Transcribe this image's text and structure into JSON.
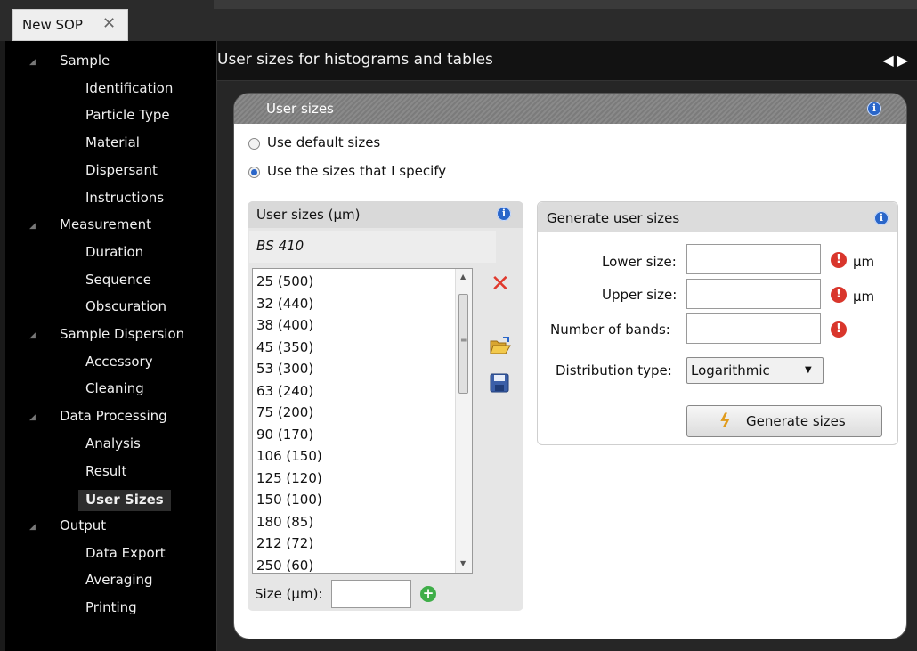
{
  "tab": {
    "label": "New SOP",
    "close": "✕"
  },
  "nav": [
    {
      "label": "Sample",
      "group": true
    },
    {
      "label": "Identification"
    },
    {
      "label": "Particle Type"
    },
    {
      "label": "Material"
    },
    {
      "label": "Dispersant"
    },
    {
      "label": "Instructions"
    },
    {
      "label": "Measurement",
      "group": true
    },
    {
      "label": "Duration"
    },
    {
      "label": "Sequence"
    },
    {
      "label": "Obscuration"
    },
    {
      "label": "Sample Dispersion",
      "group": true
    },
    {
      "label": "Accessory"
    },
    {
      "label": "Cleaning"
    },
    {
      "label": "Data Processing",
      "group": true
    },
    {
      "label": "Analysis"
    },
    {
      "label": "Result"
    },
    {
      "label": "User Sizes",
      "selected": true
    },
    {
      "label": "Output",
      "group": true
    },
    {
      "label": "Data Export"
    },
    {
      "label": "Averaging"
    },
    {
      "label": "Printing"
    }
  ],
  "header": {
    "title": "User sizes for histograms and tables"
  },
  "card": {
    "title": "User sizes"
  },
  "options": {
    "default_sizes": "Use default sizes",
    "specify_sizes": "Use the sizes that I specify",
    "selected": "specify_sizes"
  },
  "left_panel": {
    "title": "User sizes (µm)",
    "preset": "BS 410",
    "items": [
      "25 (500)",
      "32 (440)",
      "38 (400)",
      "45 (350)",
      "53 (300)",
      "63 (240)",
      "75 (200)",
      "90 (170)",
      "106 (150)",
      "125 (120)",
      "150 (100)",
      "180 (85)",
      "212 (72)",
      "250 (60)"
    ],
    "size_label": "Size (µm):",
    "size_value": ""
  },
  "right_panel": {
    "title": "Generate user sizes",
    "lower_label": "Lower size:",
    "upper_label": "Upper size:",
    "bands_label": "Number of bands:",
    "unit": "µm",
    "distribution_label": "Distribution type:",
    "distribution_value": "Logarithmic",
    "generate_label": "Generate sizes"
  },
  "colors": {
    "accent_blue": "#2a66c9",
    "warning_red": "#d9362c",
    "delete_red": "#e03a2e",
    "add_green": "#3fae49"
  }
}
